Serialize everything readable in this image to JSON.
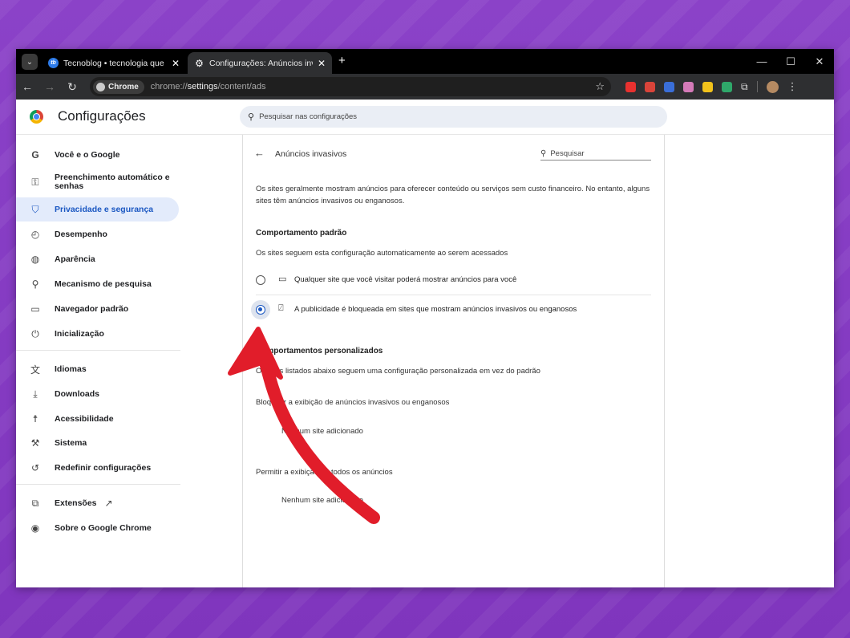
{
  "tabs": [
    {
      "title": "Tecnoblog • tecnologia que inte",
      "favicon_text": "tb",
      "close": "✕",
      "active": false
    },
    {
      "title": "Configurações: Anúncios invasivo",
      "favicon_text": "⚙",
      "close": "✕",
      "active": true
    }
  ],
  "tab_search_glyph": "⌄",
  "new_tab_glyph": "+",
  "window_controls": {
    "minimize": "—",
    "maximize": "☐",
    "close": "✕"
  },
  "toolbar": {
    "back": "←",
    "forward": "→",
    "reload": "↻",
    "chip_label": "Chrome",
    "url_prefix": "chrome://",
    "url_bold": "settings",
    "url_suffix": "/content/ads",
    "bookmark": "☆",
    "menu": "⋮",
    "extension_colors": [
      "#e8312f",
      "#d9443a",
      "#3a6ed8",
      "#d47ab8",
      "#f2c21b",
      "#2fa86a"
    ]
  },
  "header": {
    "title": "Configurações",
    "search_placeholder": "Pesquisar nas configurações"
  },
  "sidebar": {
    "items": [
      {
        "label": "Você e o Google",
        "icon": "google-icon",
        "glyph": "G"
      },
      {
        "label": "Preenchimento automático e senhas",
        "icon": "key-icon",
        "glyph": "⚿"
      },
      {
        "label": "Privacidade e segurança",
        "icon": "shield-icon",
        "glyph": "⛉",
        "active": true
      },
      {
        "label": "Desempenho",
        "icon": "speedometer-icon",
        "glyph": "◴"
      },
      {
        "label": "Aparência",
        "icon": "palette-icon",
        "glyph": "◍"
      },
      {
        "label": "Mecanismo de pesquisa",
        "icon": "search-icon",
        "glyph": "⚲"
      },
      {
        "label": "Navegador padrão",
        "icon": "browser-icon",
        "glyph": "▭"
      },
      {
        "label": "Inicialização",
        "icon": "power-icon",
        "glyph": "⏻"
      },
      {
        "label": "Idiomas",
        "icon": "translate-icon",
        "glyph": "文"
      },
      {
        "label": "Downloads",
        "icon": "download-icon",
        "glyph": "⤓"
      },
      {
        "label": "Acessibilidade",
        "icon": "accessibility-icon",
        "glyph": "☨"
      },
      {
        "label": "Sistema",
        "icon": "wrench-icon",
        "glyph": "⚒"
      },
      {
        "label": "Redefinir configurações",
        "icon": "reset-icon",
        "glyph": "↺"
      },
      {
        "label": "Extensões",
        "icon": "puzzle-icon",
        "glyph": "⧉"
      },
      {
        "label": "Sobre o Google Chrome",
        "icon": "chrome-icon",
        "glyph": "◉"
      }
    ],
    "external_glyph": "↗"
  },
  "panel": {
    "back_glyph": "←",
    "title": "Anúncios invasivos",
    "search_placeholder": "Pesquisar",
    "description": "Os sites geralmente mostram anúncios para oferecer conteúdo ou serviços sem custo financeiro. No entanto, alguns sites têm anúncios invasivos ou enganosos.",
    "default_behavior_title": "Comportamento padrão",
    "default_behavior_desc": "Os sites seguem esta configuração automaticamente ao serem acessados",
    "options": [
      {
        "label": "Qualquer site que você visitar poderá mostrar anúncios para você",
        "icon": "window-icon",
        "glyph": "▭",
        "selected": false
      },
      {
        "label": "A publicidade é bloqueada em sites que mostram anúncios invasivos ou enganosos",
        "icon": "ad-blocked-icon",
        "glyph": "⍁",
        "selected": true
      }
    ],
    "custom_title": "Comportamentos personalizados",
    "custom_desc": "Os sites listados abaixo seguem uma configuração personalizada em vez do padrão",
    "block_title": "Bloquear a exibição de anúncios invasivos ou enganosos",
    "block_empty": "Nenhum site adicionado",
    "allow_title": "Permitir a exibição de todos os anúncios",
    "allow_empty": "Nenhum site adicionado"
  }
}
